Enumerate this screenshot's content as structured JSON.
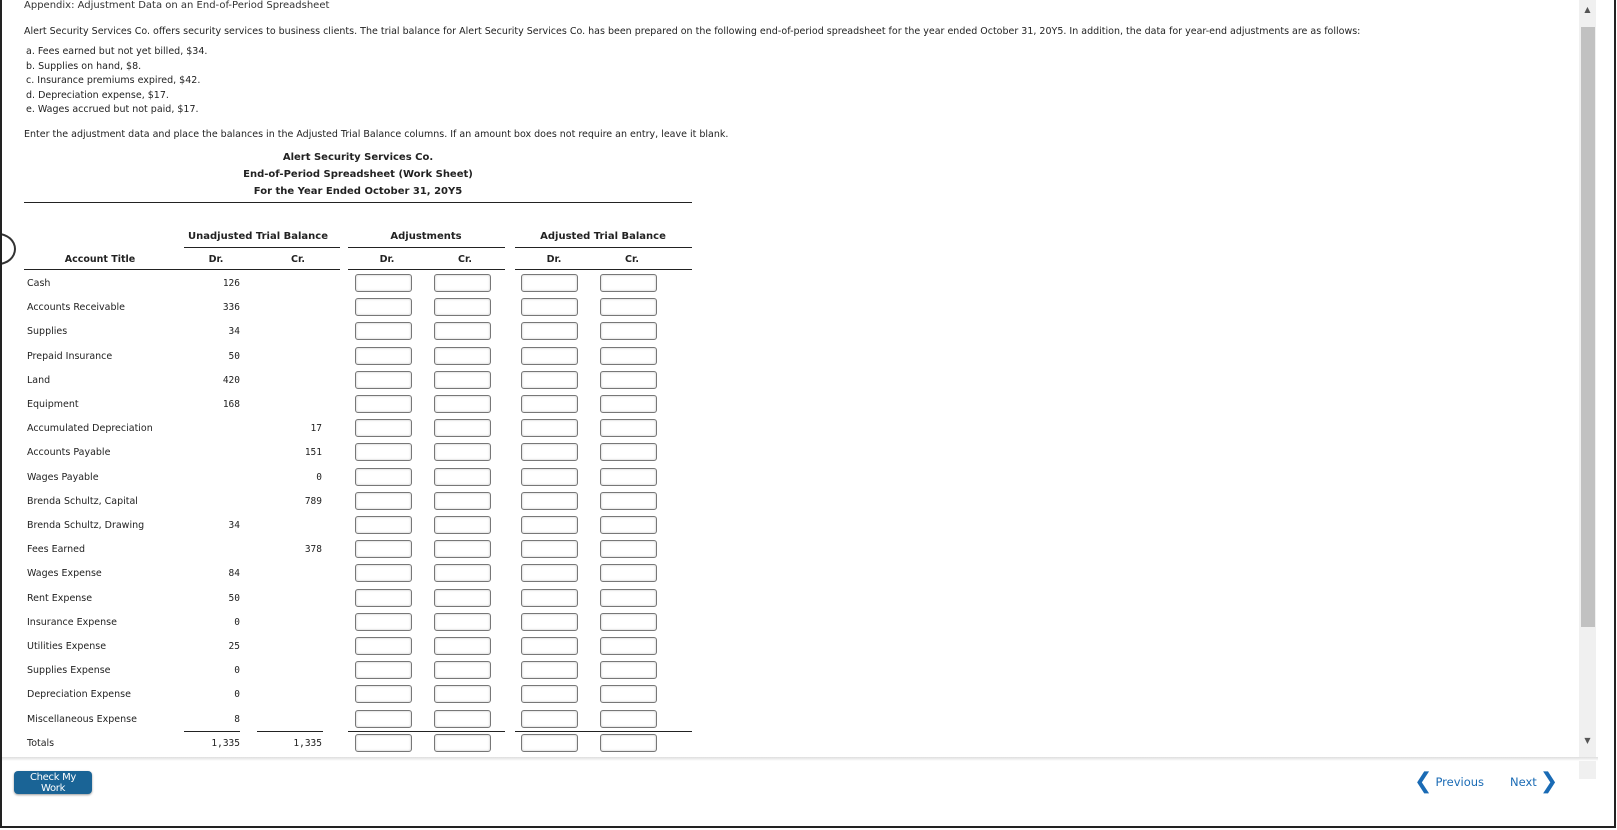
{
  "header": {
    "appendix_title": "Appendix: Adjustment Data on an End-of-Period Spreadsheet"
  },
  "problem": {
    "intro": "Alert Security Services Co. offers security services to business clients. The trial balance for Alert Security Services Co. has been prepared on the following end-of-period spreadsheet for the year ended October 31, 20Y5. In addition, the data for year-end adjustments are as follows:",
    "adjustments": [
      "a. Fees earned but not yet billed, $34.",
      "b. Supplies on hand, $8.",
      "c. Insurance premiums expired, $42.",
      "d. Depreciation expense, $17.",
      "e. Wages accrued but not paid, $17."
    ],
    "instruction": "Enter the adjustment data and place the balances in the Adjusted Trial Balance columns.  If an amount box does not require an entry, leave it blank."
  },
  "worksheet": {
    "company": "Alert Security Services Co.",
    "title": "End-of-Period Spreadsheet (Work Sheet)",
    "period": "For the Year Ended October 31, 20Y5",
    "group_headers": {
      "unadjusted": "Unadjusted Trial Balance",
      "adjustments": "Adjustments",
      "adjusted": "Adjusted Trial Balance"
    },
    "column_headers": {
      "account_title": "Account Title",
      "dr": "Dr.",
      "cr": "Cr."
    },
    "rows": [
      {
        "account": "Cash",
        "dr": "126",
        "cr": ""
      },
      {
        "account": "Accounts Receivable",
        "dr": "336",
        "cr": ""
      },
      {
        "account": "Supplies",
        "dr": "34",
        "cr": ""
      },
      {
        "account": "Prepaid Insurance",
        "dr": "50",
        "cr": ""
      },
      {
        "account": "Land",
        "dr": "420",
        "cr": ""
      },
      {
        "account": "Equipment",
        "dr": "168",
        "cr": ""
      },
      {
        "account": "Accumulated Depreciation",
        "dr": "",
        "cr": "17"
      },
      {
        "account": "Accounts Payable",
        "dr": "",
        "cr": "151"
      },
      {
        "account": "Wages Payable",
        "dr": "",
        "cr": "0"
      },
      {
        "account": "Brenda Schultz, Capital",
        "dr": "",
        "cr": "789"
      },
      {
        "account": "Brenda Schultz, Drawing",
        "dr": "34",
        "cr": ""
      },
      {
        "account": "Fees Earned",
        "dr": "",
        "cr": "378"
      },
      {
        "account": "Wages Expense",
        "dr": "84",
        "cr": ""
      },
      {
        "account": "Rent Expense",
        "dr": "50",
        "cr": ""
      },
      {
        "account": "Insurance Expense",
        "dr": "0",
        "cr": ""
      },
      {
        "account": "Utilities Expense",
        "dr": "25",
        "cr": ""
      },
      {
        "account": "Supplies Expense",
        "dr": "0",
        "cr": ""
      },
      {
        "account": "Depreciation Expense",
        "dr": "0",
        "cr": ""
      },
      {
        "account": "Miscellaneous Expense",
        "dr": "8",
        "cr": ""
      }
    ],
    "totals": {
      "account": "Totals",
      "dr": "1,335",
      "cr": "1,335"
    },
    "input_values": {
      "adj_dr": "",
      "adj_cr": "",
      "atb_dr": "",
      "atb_cr": ""
    }
  },
  "footer": {
    "check_label": "Check My Work",
    "previous_label": "Previous",
    "next_label": "Next"
  },
  "colors": {
    "primary_button": "#1a6496",
    "nav_link": "#1a6bb5"
  }
}
